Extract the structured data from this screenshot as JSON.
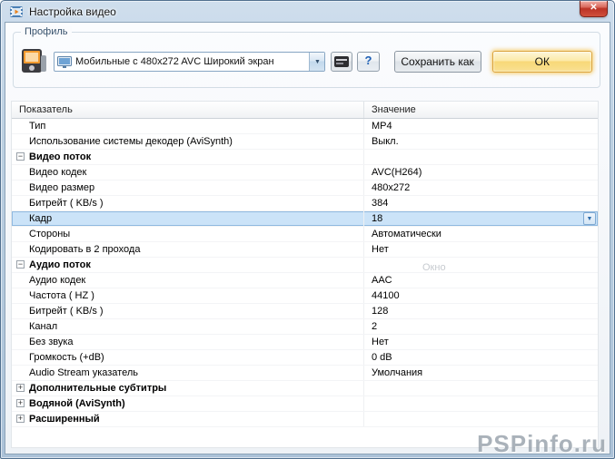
{
  "window": {
    "title": "Настройка видео",
    "close_glyph": "✕"
  },
  "profile": {
    "label": "Профиль",
    "combo_value": "Мобильные с 480x272 AVC Широкий экран",
    "combo_arrow": "▼",
    "help_label": "?",
    "save_as_label": "Сохранить как",
    "ok_label": "ОК"
  },
  "table": {
    "headers": [
      "Показатель",
      "Значение"
    ],
    "rows": [
      {
        "type": "item",
        "name": "Тип",
        "value": "MP4"
      },
      {
        "type": "item",
        "name": "Использование системы декодер (AviSynth)",
        "value": "Выкл."
      },
      {
        "type": "group",
        "name": "Видео поток",
        "value": "",
        "expanded": true
      },
      {
        "type": "item",
        "name": "Видео кодек",
        "value": "AVC(H264)"
      },
      {
        "type": "item",
        "name": "Видео размер",
        "value": "480x272"
      },
      {
        "type": "item",
        "name": "Битрейт ( KB/s )",
        "value": "384"
      },
      {
        "type": "item",
        "name": "Кадр",
        "value": "18",
        "selected": true,
        "dropdown": true
      },
      {
        "type": "item",
        "name": "Стороны",
        "value": "Автоматически"
      },
      {
        "type": "item",
        "name": "Кодировать в 2 прохода",
        "value": "Нет"
      },
      {
        "type": "group",
        "name": "Аудио поток",
        "value": "",
        "expanded": true
      },
      {
        "type": "item",
        "name": "Аудио кодек",
        "value": "AAC"
      },
      {
        "type": "item",
        "name": "Частота ( HZ )",
        "value": "44100"
      },
      {
        "type": "item",
        "name": "Битрейт ( KB/s )",
        "value": "128"
      },
      {
        "type": "item",
        "name": "Канал",
        "value": "2"
      },
      {
        "type": "item",
        "name": "Без звука",
        "value": "Нет"
      },
      {
        "type": "item",
        "name": "Громкость (+dB)",
        "value": "0 dB"
      },
      {
        "type": "item",
        "name": "Audio Stream указатель",
        "value": "Умолчания"
      },
      {
        "type": "group",
        "name": "Дополнительные субтитры",
        "value": "",
        "expanded": false
      },
      {
        "type": "group",
        "name": "Водяной (AviSynth)",
        "value": "",
        "expanded": false
      },
      {
        "type": "group",
        "name": "Расширенный",
        "value": "",
        "expanded": false
      }
    ]
  },
  "ghost_text": "Окно",
  "watermark": "PSPinfo.ru",
  "colors": {
    "selection_bg": "#cbe3f8",
    "selection_border": "#8fb9e0",
    "ok_glow": "#f6c44e",
    "close_red": "#bb3325",
    "frame_blue": "#bcd0e2"
  }
}
